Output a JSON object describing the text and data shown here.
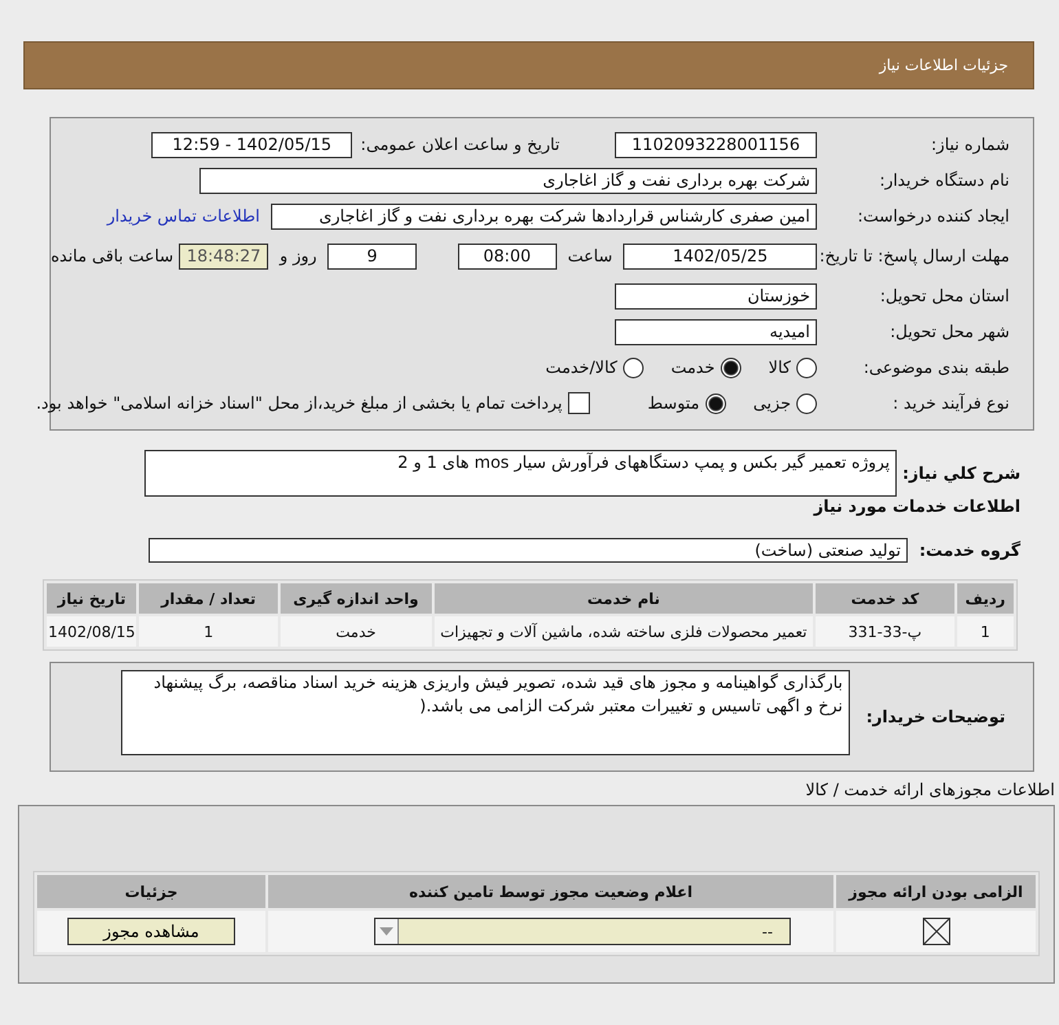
{
  "header": {
    "title": "جزئیات اطلاعات نیاز"
  },
  "need_number": {
    "label": "شماره نیاز:",
    "value": "1102093228001156"
  },
  "announce": {
    "label": "تاریخ و ساعت اعلان عمومی:",
    "value": "1402/05/15 - 12:59"
  },
  "buyer_org": {
    "label": "نام دستگاه خریدار:",
    "value": "شرکت بهره برداری نفت و گاز اغاجاری"
  },
  "requester": {
    "label": "ایجاد کننده درخواست:",
    "value": "امین صفری کارشناس قراردادها شرکت بهره برداری نفت و گاز اغاجاری",
    "link": "اطلاعات تماس خریدار"
  },
  "deadline": {
    "label": "مهلت ارسال پاسخ: تا تاریخ:",
    "date": "1402/05/25",
    "time_label": "ساعت",
    "time": "08:00",
    "days": "9",
    "days_label": "روز و",
    "remaining": "18:48:27",
    "remaining_label": "ساعت باقی مانده"
  },
  "province": {
    "label": "استان محل تحویل:",
    "value": "خوزستان"
  },
  "city": {
    "label": "شهر محل تحویل:",
    "value": "امیدیه"
  },
  "category": {
    "label": "طبقه بندی موضوعی:",
    "options": [
      {
        "label": "کالا",
        "selected": false
      },
      {
        "label": "خدمت",
        "selected": true
      },
      {
        "label": "کالا/خدمت",
        "selected": false
      }
    ]
  },
  "process": {
    "label": "نوع فرآیند خرید :",
    "options": [
      {
        "label": "جزیی",
        "selected": false
      },
      {
        "label": "متوسط",
        "selected": true
      }
    ],
    "payment": {
      "label": "پرداخت تمام یا بخشی از مبلغ خرید،از محل \"اسناد خزانه اسلامی\" خواهد بود.",
      "checked": false
    }
  },
  "summary": {
    "label": "شرح کلي نياز:",
    "value": "پروژه تعمیر گیر بکس و پمپ دستگاههای فرآورش سیار mos های 1 و 2"
  },
  "services": {
    "title": "اطلاعات خدمات مورد نياز",
    "group_label": "گروه خدمت:",
    "group_value": "تولید صنعتی (ساخت)",
    "columns": [
      "ردیف",
      "کد خدمت",
      "نام خدمت",
      "واحد اندازه گیری",
      "تعداد / مقدار",
      "تاریخ نیاز"
    ],
    "rows": [
      [
        "1",
        "پ-33-331",
        "تعمیر محصولات فلزی ساخته شده، ماشین آلات و تجهیزات",
        "خدمت",
        "1",
        "1402/08/15"
      ]
    ]
  },
  "buyer_notes": {
    "label": "توضیحات خریدار:",
    "text": "بارگذاری گواهینامه و مجوز های قید شده، تصویر فیش واریزی هزینه خرید اسناد مناقصه، برگ پیشنهاد نرخ و اگهی تاسیس و تغییرات معتبر شرکت الزامی می باشد.("
  },
  "permits": {
    "title": "اطلاعات مجوزهای ارائه خدمت / کالا",
    "columns": [
      "الزامی بودن ارائه مجوز",
      "اعلام وضعیت مجوز توسط تامین کننده",
      "جزئیات"
    ],
    "rows": [
      {
        "required": true,
        "status": "--",
        "button": "مشاهده مجوز"
      }
    ]
  }
}
